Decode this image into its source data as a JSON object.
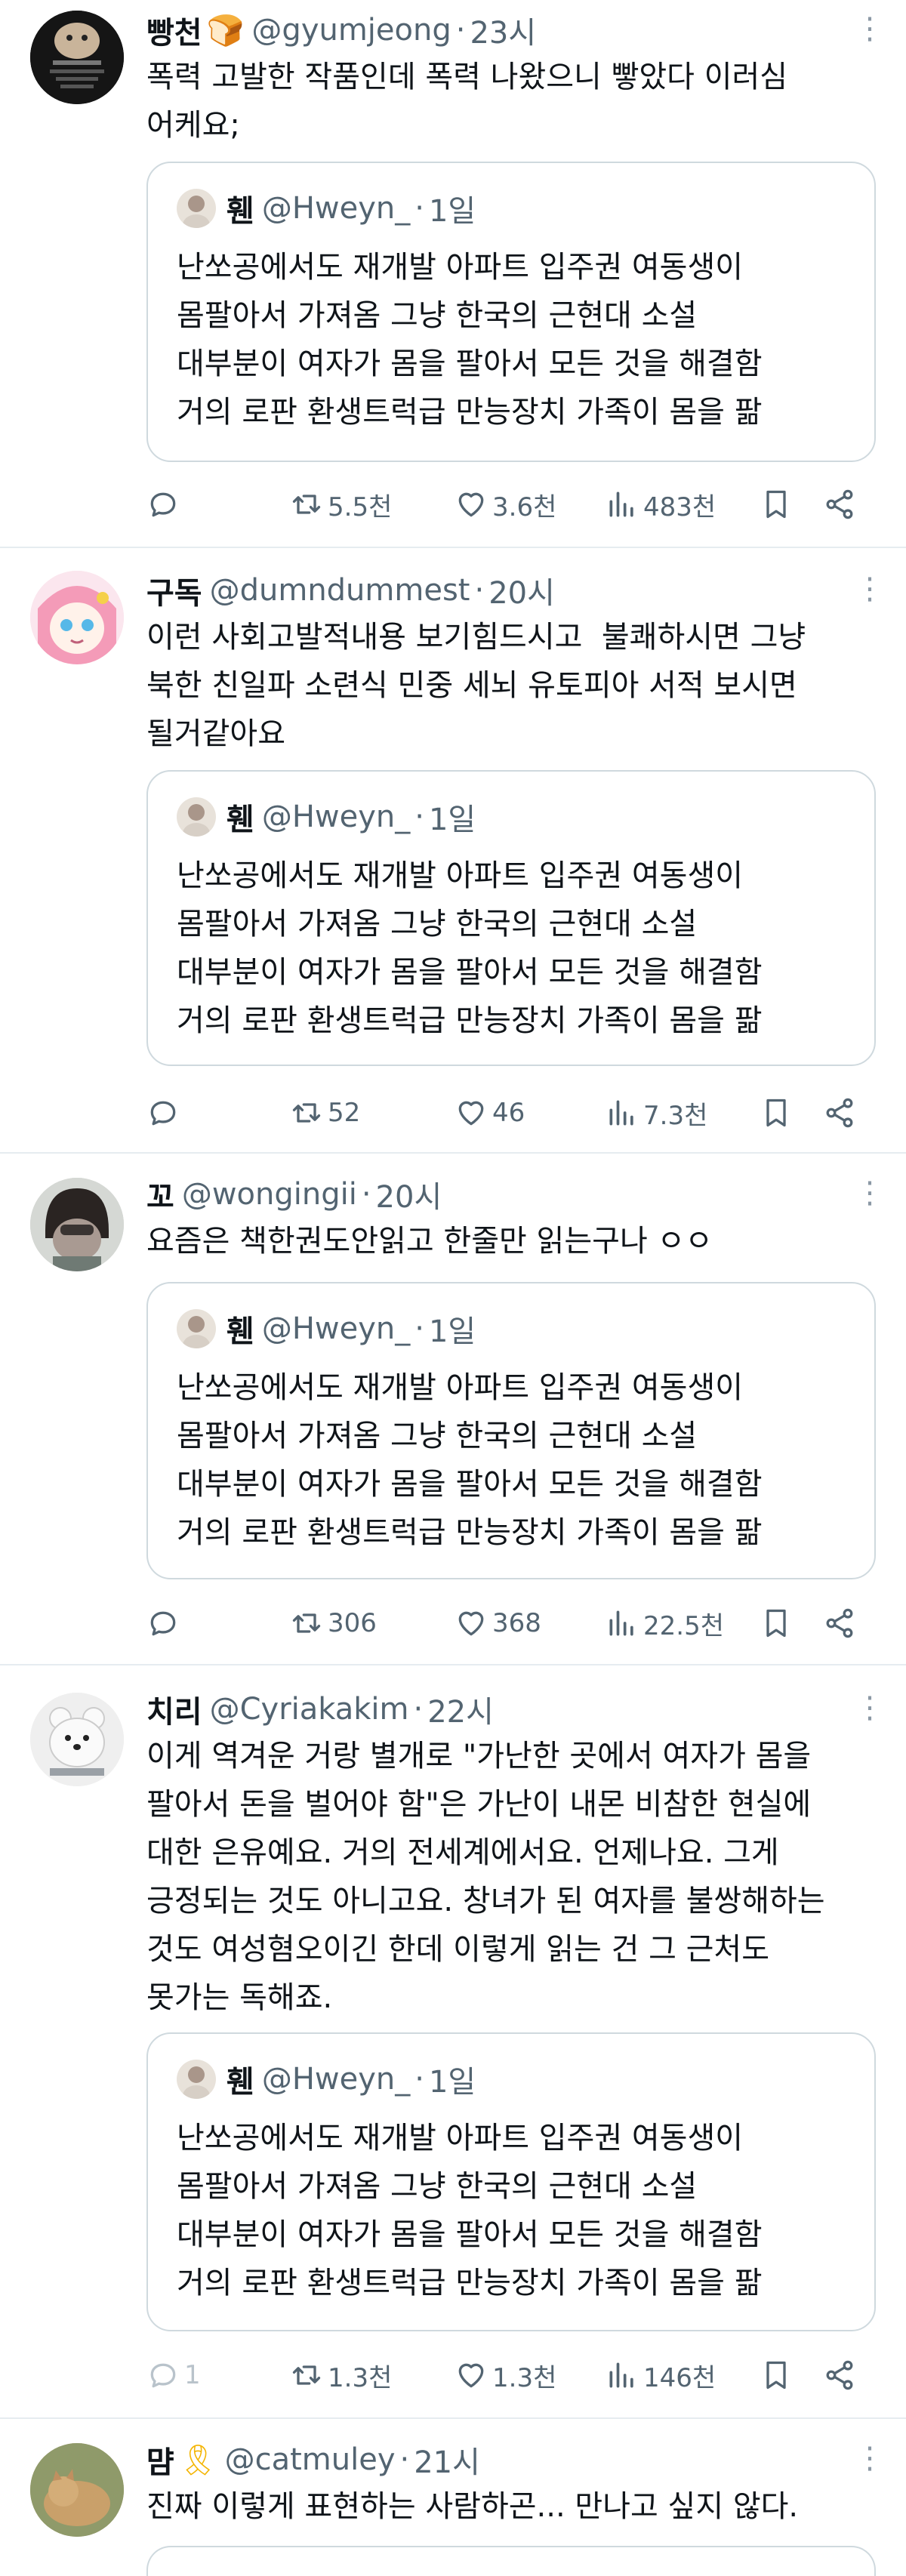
{
  "tweets": [
    {
      "name": "빵천",
      "emoji": "🍞",
      "handle": "@gyumjeong",
      "time": "23시",
      "text": "폭력 고발한 작품인데 폭력 나왔으니 빻았다 이러심\n어케요;",
      "quote": {
        "name": "휀",
        "handle": "@Hweyn_",
        "time": "1일",
        "text": "난쏘공에서도 재개발 아파트 입주권 여동생이\n몸팔아서 가져옴 그냥 한국의 근현대 소설\n대부분이 여자가 몸을 팔아서 모든 것을 해결함\n거의 로판 환생트럭급 만능장치 가족이 몸을 팖"
      },
      "reply_count": "",
      "retweet_count": "5.5천",
      "like_count": "3.6천",
      "view_count": "483천"
    },
    {
      "name": "구독",
      "emoji": "",
      "handle": "@dumndummest",
      "time": "20시",
      "text": "이런 사회고발적내용 보기힘드시고  불쾌하시면 그냥\n북한 친일파 소련식 민중 세뇌 유토피아 서적 보시면\n될거같아요",
      "quote": {
        "name": "휀",
        "handle": "@Hweyn_",
        "time": "1일",
        "text": "난쏘공에서도 재개발 아파트 입주권 여동생이\n몸팔아서 가져옴 그냥 한국의 근현대 소설\n대부분이 여자가 몸을 팔아서 모든 것을 해결함\n거의 로판 환생트럭급 만능장치 가족이 몸을 팖"
      },
      "reply_count": "",
      "retweet_count": "52",
      "like_count": "46",
      "view_count": "7.3천"
    },
    {
      "name": "꼬",
      "emoji": "",
      "handle": "@wongingii",
      "time": "20시",
      "text": "요즘은 책한권도안읽고 한줄만 읽는구나 ㅇㅇ",
      "quote": {
        "name": "휀",
        "handle": "@Hweyn_",
        "time": "1일",
        "text": "난쏘공에서도 재개발 아파트 입주권 여동생이\n몸팔아서 가져옴 그냥 한국의 근현대 소설\n대부분이 여자가 몸을 팔아서 모든 것을 해결함\n거의 로판 환생트럭급 만능장치 가족이 몸을 팖"
      },
      "reply_count": "",
      "retweet_count": "306",
      "like_count": "368",
      "view_count": "22.5천"
    },
    {
      "name": "치리",
      "emoji": "",
      "handle": "@Cyriakakim",
      "time": "22시",
      "text": "이게 역겨운 거랑 별개로 \"가난한 곳에서 여자가 몸을\n팔아서 돈을 벌어야 함\"은 가난이 내몬 비참한 현실에\n대한 은유예요. 거의 전세계에서요. 언제나요. 그게\n긍정되는 것도 아니고요. 창녀가 된 여자를 불쌍해하는\n것도 여성혐오이긴 한데 이렇게 읽는 건 그 근처도\n못가는 독해죠.",
      "quote": {
        "name": "휀",
        "handle": "@Hweyn_",
        "time": "1일",
        "text": "난쏘공에서도 재개발 아파트 입주권 여동생이\n몸팔아서 가져옴 그냥 한국의 근현대 소설\n대부분이 여자가 몸을 팔아서 모든 것을 해결함\n거의 로판 환생트럭급 만능장치 가족이 몸을 팖"
      },
      "reply_count": "1",
      "retweet_count": "1.3천",
      "like_count": "1.3천",
      "view_count": "146천"
    },
    {
      "name": "먐",
      "emoji": "🎗",
      "handle": "@catmuley",
      "time": "21시",
      "text": "진짜 이렇게 표현하는 사람하곤... 만나고 싶지 않다."
    }
  ],
  "colors": {
    "text": "#0f1419",
    "muted": "#536471",
    "border": "#cfd9de",
    "divider": "#e6ecf0"
  }
}
